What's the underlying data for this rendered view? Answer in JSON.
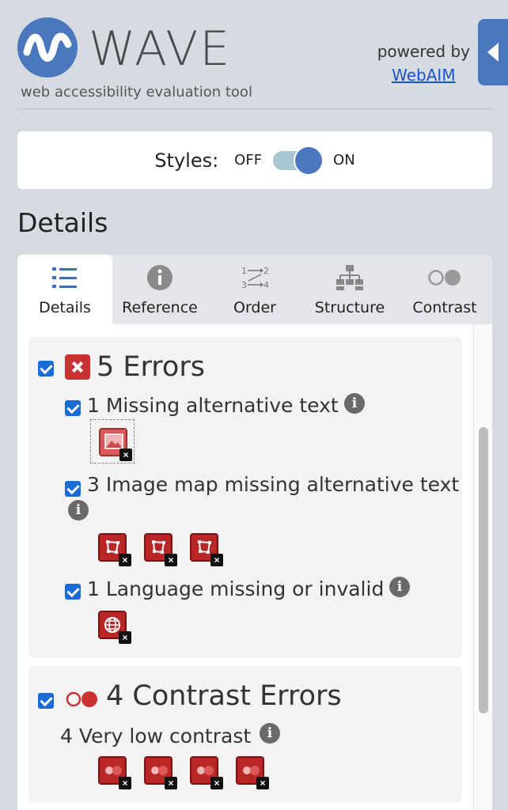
{
  "header": {
    "logo_text": "WAVE",
    "tagline": "web accessibility evaluation tool",
    "powered_by": "powered by",
    "webaim_link": "WebAIM"
  },
  "styles_toggle": {
    "label": "Styles:",
    "off": "OFF",
    "on": "ON",
    "state": "on"
  },
  "details_heading": "Details",
  "tabs": [
    {
      "label": "Details",
      "icon": "list-icon",
      "active": true
    },
    {
      "label": "Reference",
      "icon": "info-icon"
    },
    {
      "label": "Order",
      "icon": "order-icon"
    },
    {
      "label": "Structure",
      "icon": "structure-icon"
    },
    {
      "label": "Contrast",
      "icon": "contrast-icon"
    }
  ],
  "errors": {
    "title": "5 Errors",
    "items": [
      {
        "label": "1 Missing alternative text",
        "count": 1,
        "icon": "missing-alt-image-icon"
      },
      {
        "label": "3 Image map missing alternative text",
        "count": 3,
        "icon": "image-map-icon"
      },
      {
        "label": "1 Language missing or invalid",
        "count": 1,
        "icon": "globe-icon"
      }
    ]
  },
  "contrast": {
    "title": "4 Contrast Errors",
    "items": [
      {
        "label": "4 Very low contrast",
        "count": 4,
        "icon": "contrast-error-icon"
      }
    ]
  },
  "colors": {
    "accent": "#4a77bd",
    "error": "#c83232",
    "link": "#1a55c8",
    "checkbox": "#1b6bd6"
  }
}
